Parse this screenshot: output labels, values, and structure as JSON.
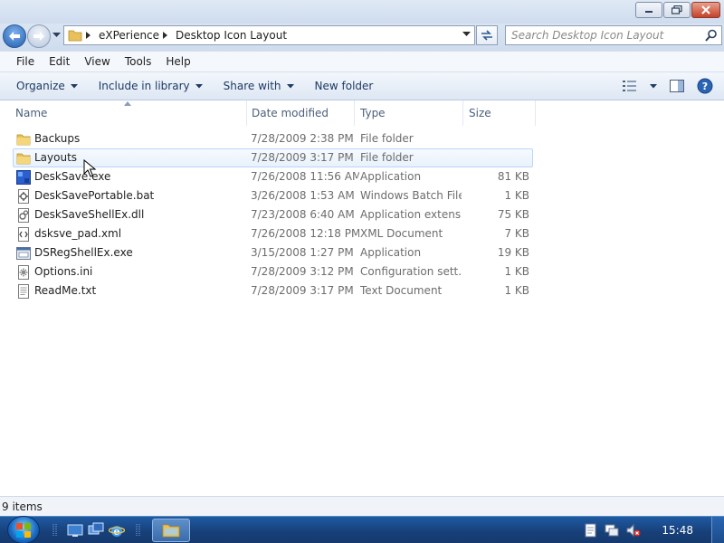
{
  "address": {
    "segments": [
      "eXPerience",
      "Desktop Icon Layout"
    ]
  },
  "search": {
    "placeholder": "Search Desktop Icon Layout"
  },
  "menu": {
    "items": [
      "File",
      "Edit",
      "View",
      "Tools",
      "Help"
    ]
  },
  "commands": {
    "organize": "Organize",
    "include": "Include in library",
    "share": "Share with",
    "new_folder": "New folder"
  },
  "columns": {
    "name": "Name",
    "date": "Date modified",
    "type": "Type",
    "size": "Size"
  },
  "files": [
    {
      "name": "Backups",
      "date": "7/28/2009 2:38 PM",
      "type": "File folder",
      "size": "",
      "icon": "folder-icon"
    },
    {
      "name": "Layouts",
      "date": "7/28/2009 3:17 PM",
      "type": "File folder",
      "size": "",
      "icon": "folder-icon"
    },
    {
      "name": "DeskSave.exe",
      "date": "7/26/2008 11:56 AM",
      "type": "Application",
      "size": "81 KB",
      "icon": "application-icon"
    },
    {
      "name": "DeskSavePortable.bat",
      "date": "3/26/2008 1:53 AM",
      "type": "Windows Batch File",
      "size": "1 KB",
      "icon": "batch-file-icon"
    },
    {
      "name": "DeskSaveShellEx.dll",
      "date": "7/23/2008 6:40 AM",
      "type": "Application extens...",
      "size": "75 KB",
      "icon": "dll-file-icon"
    },
    {
      "name": "dsksve_pad.xml",
      "date": "7/26/2008 12:18 PM",
      "type": "XML Document",
      "size": "7 KB",
      "icon": "xml-file-icon"
    },
    {
      "name": "DSRegShellEx.exe",
      "date": "3/15/2008 1:27 PM",
      "type": "Application",
      "size": "19 KB",
      "icon": "exe-file-icon"
    },
    {
      "name": "Options.ini",
      "date": "7/28/2009 3:12 PM",
      "type": "Configuration sett...",
      "size": "1 KB",
      "icon": "ini-file-icon"
    },
    {
      "name": "ReadMe.txt",
      "date": "7/28/2009 3:17 PM",
      "type": "Text Document",
      "size": "1 KB",
      "icon": "text-file-icon"
    }
  ],
  "status": {
    "item_count": "9 items"
  },
  "taskbar": {
    "clock": "15:48"
  },
  "colors": {
    "hover_border": "#b8d6fb",
    "folder_yellow": "#e8c15a",
    "taskbar_blue": "#1f5aa2"
  }
}
